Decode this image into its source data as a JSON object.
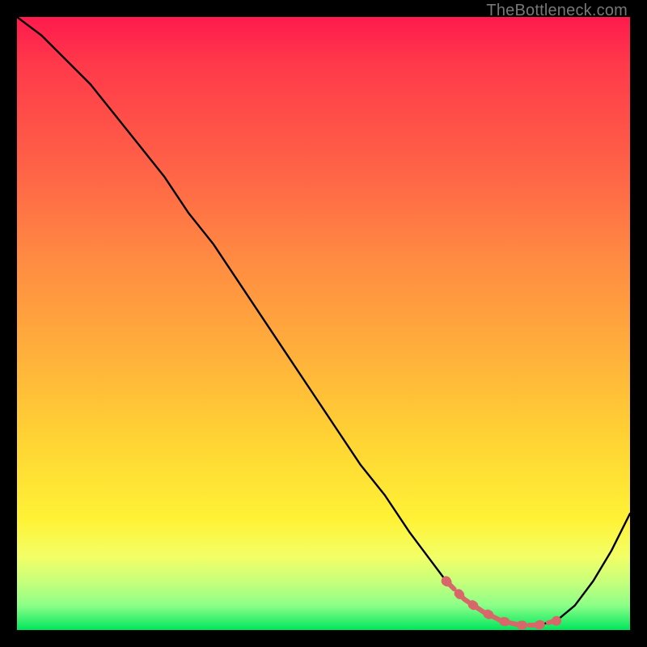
{
  "watermark": "TheBottleneck.com",
  "colors": {
    "frame": "#000000",
    "curve": "#000000",
    "marker": "#d8676a"
  },
  "chart_data": {
    "type": "line",
    "title": "",
    "xlabel": "",
    "ylabel": "",
    "xlim": [
      0,
      100
    ],
    "ylim": [
      0,
      100
    ],
    "series": [
      {
        "name": "bottleneck-curve",
        "x": [
          0,
          4,
          8,
          12,
          16,
          20,
          24,
          28,
          32,
          36,
          40,
          44,
          48,
          52,
          56,
          60,
          64,
          67,
          70,
          73,
          76,
          79,
          82,
          85,
          88,
          91,
          94,
          97,
          100
        ],
        "y": [
          100,
          97,
          93,
          89,
          84,
          79,
          74,
          68,
          63,
          57,
          51,
          45,
          39,
          33,
          27,
          22,
          16,
          12,
          8,
          5,
          3,
          1.5,
          0.8,
          0.8,
          1.5,
          4,
          8,
          13,
          19
        ]
      }
    ],
    "markers": {
      "name": "optimal-region",
      "x": [
        70,
        73,
        76,
        79,
        82,
        85,
        88
      ],
      "y": [
        8,
        5,
        3,
        1.5,
        0.8,
        0.8,
        1.5
      ]
    }
  }
}
